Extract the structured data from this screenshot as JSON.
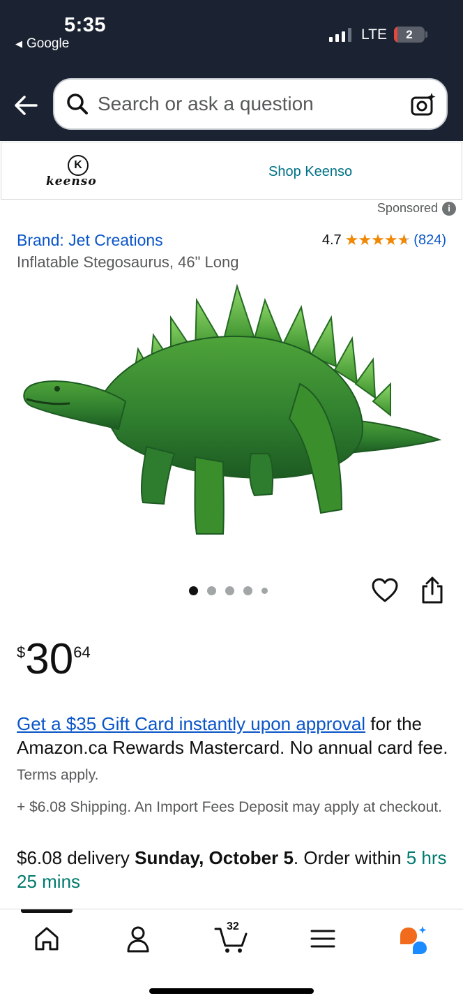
{
  "status_bar": {
    "time": "5:35",
    "back_app": "Google",
    "network": "LTE",
    "battery_badge": "2"
  },
  "search": {
    "placeholder": "Search or ask a question"
  },
  "brand_strip": {
    "logo_letter": "K",
    "logo_text": "keenso",
    "shop_link": "Shop Keenso"
  },
  "sponsored_label": "Sponsored",
  "product": {
    "brand_link": "Brand: Jet Creations",
    "title": "Inflatable Stegosaurus, 46\" Long",
    "rating_value": "4.7",
    "rating_stars": 4.7,
    "rating_count": "(824)",
    "image_icon": "stegosaurus-image",
    "carousel_dots": 5,
    "carousel_active_index": 0
  },
  "price": {
    "currency": "$",
    "whole": "30",
    "fraction": "64"
  },
  "promo": {
    "link_text": "Get a $35 Gift Card instantly upon approval",
    "body_text": " for the Amazon.ca Rewards Mastercard. No annual card fee.",
    "terms": " Terms apply."
  },
  "shipping": "+ $6.08 Shipping. An Import Fees Deposit may apply at checkout.",
  "delivery": {
    "prefix": "$6.08 delivery ",
    "date": "Sunday, October 5",
    "middle": ". Order within ",
    "countdown": "5 hrs 25 mins"
  },
  "bottom_nav": {
    "cart_count": "32",
    "items": [
      "home-icon",
      "account-icon",
      "cart-icon",
      "menu-icon",
      "rufus-icon"
    ]
  },
  "colors": {
    "header_bg": "#1b2332",
    "link_blue": "#0a55c8",
    "teal": "#007185",
    "star_orange": "#f08804",
    "delivery_green": "#007a6e"
  }
}
